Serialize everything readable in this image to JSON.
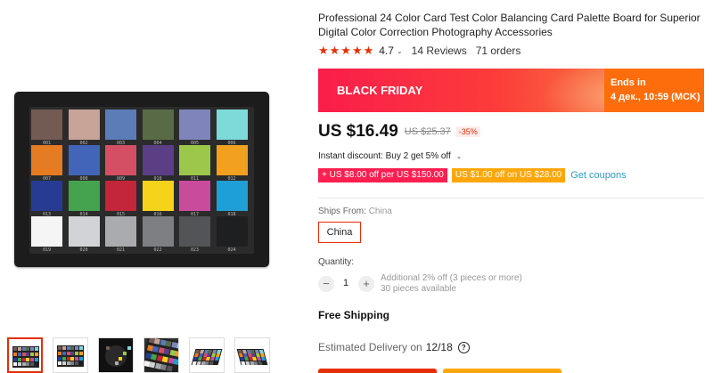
{
  "product": {
    "title": "Professional 24 Color Card Test Color Balancing Card Palette Board for Superior Digital Color Correction Photography Accessories",
    "rating": "4.7",
    "stars": "★★★★★",
    "reviews": "14 Reviews",
    "orders": "71 orders"
  },
  "banner": {
    "label": "BLACK FRIDAY",
    "ends_label": "Ends in",
    "ends_time": "4 дек., 10:59 (MCK)"
  },
  "price": {
    "current": "US $16.49",
    "old": "US $25.37",
    "discount": "-35%"
  },
  "instant_discount": "Instant discount: Buy 2 get 5% off",
  "coupons": {
    "coupon1": "+ US $8.00 off per US $150.00",
    "coupon2": "US $1.00 off on US $28.00",
    "link": "Get coupons"
  },
  "shipping": {
    "label": "Ships From:",
    "value": "China",
    "option": "China",
    "free": "Free Shipping",
    "delivery_label": "Estimated Delivery on",
    "delivery_date": "12/18",
    "help_icon": "?"
  },
  "quantity": {
    "label": "Quantity:",
    "minus": "−",
    "plus": "+",
    "value": "1",
    "note_line1": "Additional 2% off (3 pieces or more)",
    "note_line2": "30 pieces available"
  },
  "color_card": {
    "swatch_colors": [
      "#735a52",
      "#c8a398",
      "#5b7cb6",
      "#586b46",
      "#7f84ba",
      "#7ed9d9",
      "#e57b22",
      "#4265ba",
      "#d44f64",
      "#5c3e86",
      "#9dc74a",
      "#f2a020",
      "#283b93",
      "#45a34f",
      "#c3253a",
      "#f5d31a",
      "#c94c9c",
      "#1f9fd6",
      "#f5f5f5",
      "#d2d3d6",
      "#a9abaf",
      "#7d7f83",
      "#525458",
      "#1e1f21"
    ],
    "swatch_labels": [
      "001",
      "002",
      "003",
      "004",
      "005",
      "006",
      "007",
      "008",
      "009",
      "010",
      "011",
      "012",
      "013",
      "014",
      "015",
      "016",
      "017",
      "018",
      "019",
      "020",
      "021",
      "022",
      "023",
      "024"
    ]
  },
  "thumbnail_icons": [
    "color-card-thumb-icon",
    "color-card-thumb-icon",
    "camera-thumb-icon",
    "color-card-closeup-thumb-icon",
    "color-card-angle-thumb-icon",
    "color-card-side-thumb-icon"
  ]
}
